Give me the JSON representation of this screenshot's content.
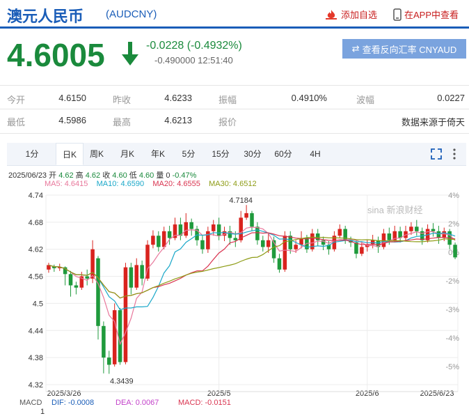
{
  "header": {
    "title": "澳元人民币",
    "code": "(AUDCNY)",
    "add_watch": "添加自选",
    "app_view": "在APP中查看"
  },
  "quote": {
    "price": "4.6005",
    "change": "-0.0228 (-0.4932%)",
    "detail": "-0.490000 12:51:40",
    "reverse_button": "查看反向汇率 CNYAUD"
  },
  "stats": [
    [
      {
        "label": "今开",
        "value": "4.6150"
      },
      {
        "label": "昨收",
        "value": "4.6233"
      },
      {
        "label": "振幅",
        "value": "0.4910%"
      },
      {
        "label": "波幅",
        "value": "0.0227"
      }
    ],
    [
      {
        "label": "最低",
        "value": "4.5986"
      },
      {
        "label": "最高",
        "value": "4.6213"
      },
      {
        "label": "报价",
        "value": ""
      },
      {
        "label": "",
        "value": "数据来源于倚天"
      }
    ]
  ],
  "tabs": [
    "1分",
    "日K",
    "周K",
    "月K",
    "年K",
    "5分",
    "15分",
    "30分",
    "60分",
    "4H"
  ],
  "active_tab": 1,
  "info_line": {
    "date": "2025/06/23",
    "open_label": "开",
    "open": "4.62",
    "high_label": "高",
    "high": "4.62",
    "close_label": "收",
    "close": "4.60",
    "low_label": "低",
    "low": "4.60",
    "vol": "量 0",
    "pct": "-0.47%"
  },
  "ma_legend": [
    {
      "text": "MA5: 4.6415",
      "color": "#e8779b"
    },
    {
      "text": "MA10: 4.6590",
      "color": "#1ba8c9"
    },
    {
      "text": "MA20: 4.6555",
      "color": "#d9334f"
    },
    {
      "text": "MA30: 4.6512",
      "color": "#8e9c16"
    }
  ],
  "chart_data": {
    "type": "candlestick",
    "y_ticks": [
      "4.74",
      "4.68",
      "4.62",
      "4.56",
      "4.5",
      "4.44",
      "4.38",
      "4.32"
    ],
    "y_ticks_pct": [
      "4%",
      "2%",
      "0%",
      "-2%",
      "-3%",
      "-4%",
      "-5%"
    ],
    "x_ticks": [
      "2025/3/26",
      "2025/5",
      "2025/6",
      "2025/6/23"
    ],
    "ylim": [
      4.32,
      4.74
    ],
    "annotations": [
      {
        "text": "4.7184",
        "value": 4.7184
      },
      {
        "text": "4.3439",
        "value": 4.3439
      }
    ],
    "candles": [
      [
        4.575,
        4.585,
        4.59,
        4.568
      ],
      [
        4.582,
        4.578,
        4.586,
        4.57
      ],
      [
        4.578,
        4.58,
        4.588,
        4.572
      ],
      [
        4.58,
        4.565,
        4.582,
        4.54
      ],
      [
        4.565,
        4.54,
        4.572,
        4.515
      ],
      [
        4.54,
        4.535,
        4.548,
        4.52
      ],
      [
        4.535,
        4.56,
        4.57,
        4.53
      ],
      [
        4.56,
        4.555,
        4.575,
        4.54
      ],
      [
        4.555,
        4.62,
        4.64,
        4.545
      ],
      [
        4.6,
        4.45,
        4.605,
        4.42
      ],
      [
        4.45,
        4.38,
        4.46,
        4.345
      ],
      [
        4.38,
        4.364,
        4.395,
        4.344
      ],
      [
        4.365,
        4.485,
        4.5,
        4.36
      ],
      [
        4.485,
        4.37,
        4.49,
        4.364
      ],
      [
        4.37,
        4.58,
        4.59,
        4.365
      ],
      [
        4.58,
        4.535,
        4.59,
        4.52
      ],
      [
        4.535,
        4.585,
        4.6,
        4.53
      ],
      [
        4.585,
        4.555,
        4.595,
        4.54
      ],
      [
        4.555,
        4.63,
        4.64,
        4.55
      ],
      [
        4.63,
        4.65,
        4.662,
        4.622
      ],
      [
        4.65,
        4.625,
        4.66,
        4.615
      ],
      [
        4.625,
        4.66,
        4.67,
        4.62
      ],
      [
        4.66,
        4.645,
        4.672,
        4.63
      ],
      [
        4.645,
        4.675,
        4.69,
        4.64
      ],
      [
        4.675,
        4.65,
        4.69,
        4.64
      ],
      [
        4.65,
        4.68,
        4.7,
        4.645
      ],
      [
        4.68,
        4.665,
        4.688,
        4.65
      ],
      [
        4.665,
        4.64,
        4.672,
        4.628
      ],
      [
        4.64,
        4.62,
        4.65,
        4.61
      ],
      [
        4.62,
        4.66,
        4.67,
        4.612
      ],
      [
        4.66,
        4.675,
        4.685,
        4.65
      ],
      [
        4.675,
        4.65,
        4.69,
        4.64
      ],
      [
        4.65,
        4.66,
        4.67,
        4.638
      ],
      [
        4.66,
        4.645,
        4.672,
        4.63
      ],
      [
        4.645,
        4.64,
        4.66,
        4.625
      ],
      [
        4.64,
        4.69,
        4.705,
        4.635
      ],
      [
        4.69,
        4.7,
        4.718,
        4.685
      ],
      [
        4.7,
        4.67,
        4.705,
        4.66
      ],
      [
        4.67,
        4.64,
        4.68,
        4.63
      ],
      [
        4.64,
        4.625,
        4.65,
        4.615
      ],
      [
        4.625,
        4.64,
        4.655,
        4.612
      ],
      [
        4.64,
        4.6,
        4.648,
        4.59
      ],
      [
        4.6,
        4.575,
        4.61,
        4.568
      ],
      [
        4.575,
        4.65,
        4.66,
        4.57
      ],
      [
        4.65,
        4.62,
        4.66,
        4.61
      ],
      [
        4.62,
        4.63,
        4.64,
        4.612
      ],
      [
        4.63,
        4.645,
        4.66,
        4.622
      ],
      [
        4.645,
        4.62,
        4.652,
        4.612
      ],
      [
        4.62,
        4.655,
        4.665,
        4.615
      ],
      [
        4.655,
        4.64,
        4.665,
        4.628
      ],
      [
        4.64,
        4.63,
        4.648,
        4.618
      ],
      [
        4.63,
        4.62,
        4.638,
        4.608
      ],
      [
        4.62,
        4.65,
        4.66,
        4.615
      ],
      [
        4.65,
        4.665,
        4.675,
        4.645
      ],
      [
        4.665,
        4.64,
        4.672,
        4.632
      ],
      [
        4.64,
        4.635,
        4.648,
        4.625
      ],
      [
        4.635,
        4.61,
        4.64,
        4.6
      ],
      [
        4.61,
        4.625,
        4.635,
        4.605
      ],
      [
        4.625,
        4.63,
        4.64,
        4.615
      ],
      [
        4.63,
        4.64,
        4.652,
        4.622
      ],
      [
        4.64,
        4.625,
        4.648,
        4.612
      ],
      [
        4.625,
        4.655,
        4.665,
        4.62
      ],
      [
        4.655,
        4.64,
        4.668,
        4.63
      ],
      [
        4.64,
        4.66,
        4.672,
        4.635
      ],
      [
        4.66,
        4.645,
        4.67,
        4.635
      ],
      [
        4.645,
        4.66,
        4.672,
        4.64
      ],
      [
        4.66,
        4.67,
        4.68,
        4.652
      ],
      [
        4.67,
        4.66,
        4.685,
        4.65
      ],
      [
        4.66,
        4.64,
        4.668,
        4.63
      ],
      [
        4.64,
        4.665,
        4.675,
        4.635
      ],
      [
        4.665,
        4.66,
        4.678,
        4.648
      ],
      [
        4.66,
        4.645,
        4.672,
        4.632
      ],
      [
        4.645,
        4.66,
        4.668,
        4.638
      ],
      [
        4.66,
        4.63,
        4.665,
        4.62
      ],
      [
        4.63,
        4.602,
        4.635,
        4.598
      ]
    ]
  },
  "macd": {
    "label": "MACD",
    "dif": "DIF: -0.0008",
    "dea": "DEA: 0.0067",
    "macd": "MACD: -0.0151",
    "tick": "1",
    "dif_color": "#1a5db8",
    "dea_color": "#c23fc9",
    "macd_color": "#d9334f"
  },
  "watermark": "sina 新浪财经"
}
